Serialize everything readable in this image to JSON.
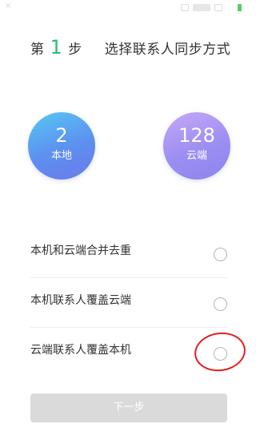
{
  "status_bar": {
    "icons": [
      "signal-icon",
      "notification-icon",
      "wifi-icon",
      "battery-icon"
    ]
  },
  "header": {
    "step_prefix": "第",
    "step_number": "1",
    "step_suffix": "步",
    "step_description": "选择联系人同步方式"
  },
  "counts": {
    "local": {
      "value": "2",
      "label": "本地"
    },
    "cloud": {
      "value": "128",
      "label": "云端"
    }
  },
  "options": [
    {
      "label": "本机和云端合并去重",
      "selected": false
    },
    {
      "label": "本机联系人覆盖云端",
      "selected": false
    },
    {
      "label": "云端联系人覆盖本机",
      "selected": false
    }
  ],
  "next_button": {
    "label": "下一步",
    "enabled": false
  },
  "colors": {
    "accent_green": "#27c06b",
    "annotation_red": "#e0201e",
    "button_disabled": "#dadada"
  }
}
